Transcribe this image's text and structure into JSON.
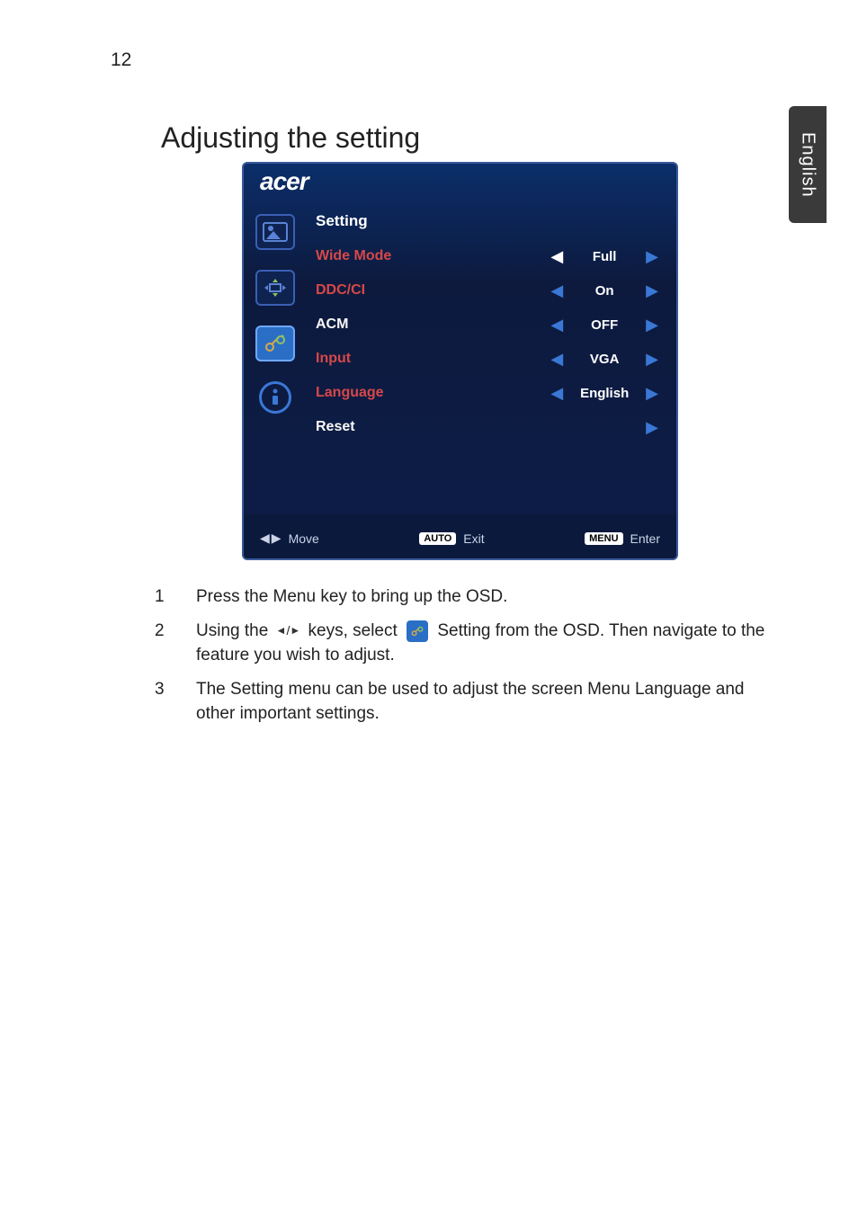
{
  "page_number": "12",
  "lang_tab": "English",
  "heading": "Adjusting the setting",
  "osd": {
    "brand": "acer",
    "menu_title": "Setting",
    "rows": [
      {
        "label": "Wide Mode",
        "color": "red",
        "left_arrow": true,
        "arrow_white": true,
        "value": "Full",
        "right_arrow": true
      },
      {
        "label": "DDC/CI",
        "color": "red",
        "left_arrow": true,
        "arrow_white": false,
        "value": "On",
        "right_arrow": true
      },
      {
        "label": "ACM",
        "color": "white",
        "left_arrow": true,
        "arrow_white": false,
        "value": "OFF",
        "right_arrow": true
      },
      {
        "label": "Input",
        "color": "red",
        "left_arrow": true,
        "arrow_white": false,
        "value": "VGA",
        "right_arrow": true
      },
      {
        "label": "Language",
        "color": "red",
        "left_arrow": true,
        "arrow_white": false,
        "value": "English",
        "right_arrow": true
      },
      {
        "label": "Reset",
        "color": "white",
        "left_arrow": false,
        "arrow_white": false,
        "value": "",
        "right_arrow": true
      }
    ],
    "footer": {
      "move": "Move",
      "auto_badge": "AUTO",
      "exit": "Exit",
      "menu_badge": "MENU",
      "enter": "Enter"
    }
  },
  "list": {
    "items": [
      {
        "num": "1",
        "text": "Press the Menu key to bring up the OSD."
      },
      {
        "num": "2",
        "text_a": "Using the ",
        "text_b": " keys, select ",
        "text_c": " Setting from the OSD. Then navigate to the feature you wish to adjust."
      },
      {
        "num": "3",
        "text": "The Setting menu can be used to adjust the screen Menu Language and other important settings."
      }
    ]
  }
}
